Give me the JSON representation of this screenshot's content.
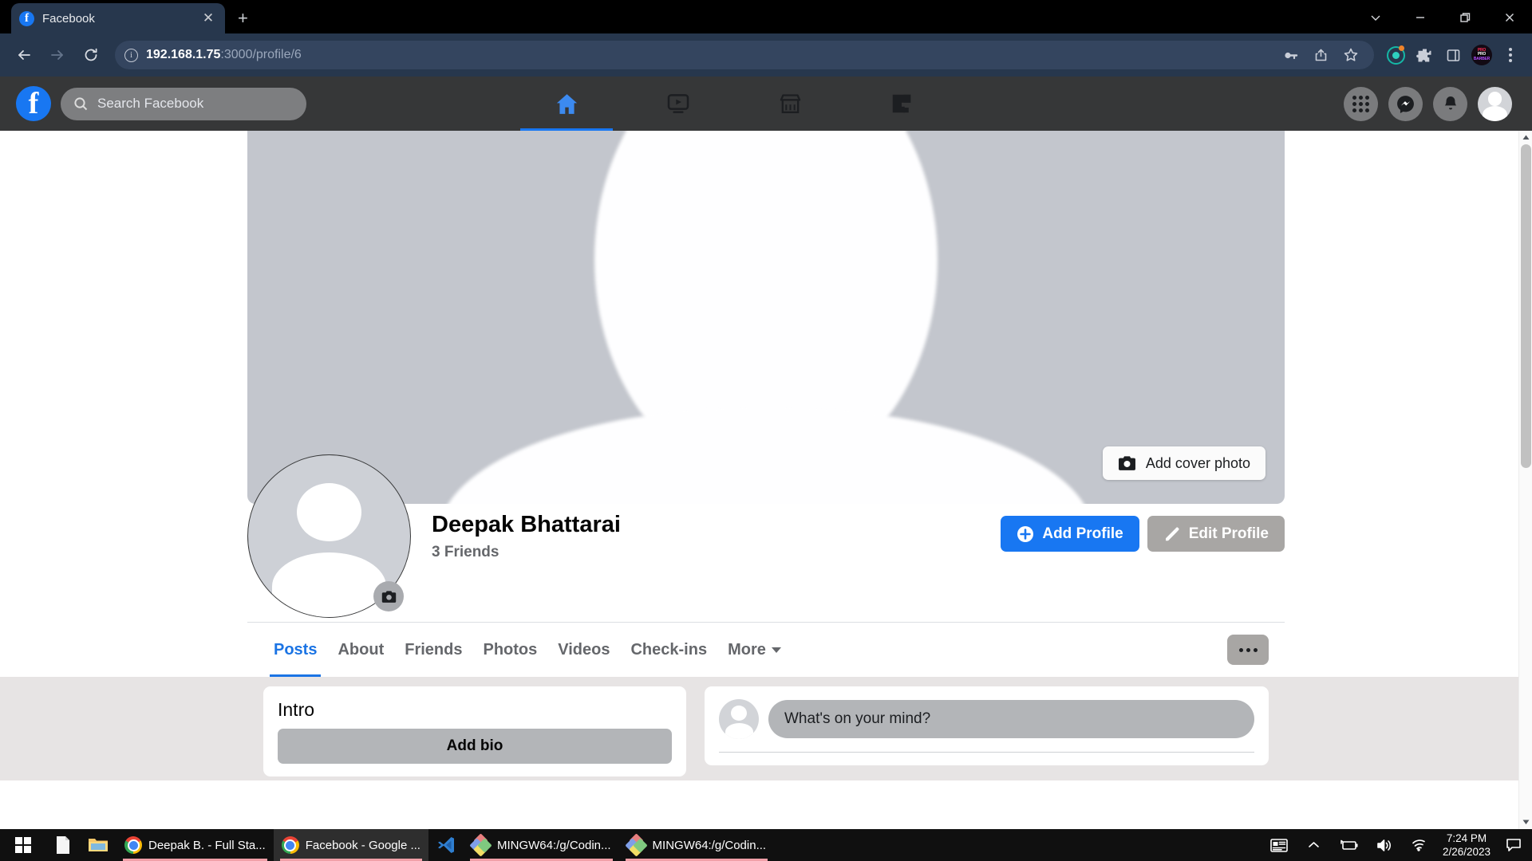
{
  "browser": {
    "tab": {
      "title": "Facebook",
      "favicon": "facebook-icon",
      "close": "✕"
    },
    "new_tab": "+",
    "window_controls": {
      "tab_search": "chevron-down-icon",
      "minimize": "minimize-icon",
      "restore": "restore-icon",
      "close": "close-icon"
    },
    "nav": {
      "back": "back-arrow-icon",
      "forward": "forward-arrow-icon",
      "reload": "reload-icon"
    },
    "omnibox": {
      "site_info": "info-icon",
      "url_host": "192.168.1.75",
      "url_path": ":3000/profile/6",
      "full_url": "192.168.1.75:3000/profile/6"
    },
    "toolbar_icons": [
      "key-icon",
      "share-icon",
      "bookmark-star-icon",
      "extension-circle-icon",
      "puzzle-extensions-icon",
      "side-panel-icon",
      "profile-badge-icon",
      "chrome-menu-icon"
    ],
    "extension_badge": {
      "line1": "PRO",
      "line2": "PRO",
      "line3": "BARBER"
    }
  },
  "fbnav": {
    "logo": "facebook-logo",
    "search": {
      "icon": "search-icon",
      "placeholder": "Search Facebook",
      "value": ""
    },
    "tabs": [
      {
        "name": "home",
        "icon": "home-icon",
        "active": true
      },
      {
        "name": "watch",
        "icon": "video-play-icon",
        "active": false
      },
      {
        "name": "marketplace",
        "icon": "marketplace-shop-icon",
        "active": false
      },
      {
        "name": "gaming",
        "icon": "gaming-icon",
        "active": false
      }
    ],
    "right": [
      {
        "name": "menu-grid",
        "icon": "grid-apps-icon"
      },
      {
        "name": "messenger",
        "icon": "messenger-icon"
      },
      {
        "name": "notifications",
        "icon": "bell-icon"
      },
      {
        "name": "account",
        "icon": "user-avatar-icon"
      }
    ]
  },
  "cover": {
    "add_cover_label": "Add cover photo",
    "camera_icon": "camera-icon",
    "background_color": "#c3c6cd"
  },
  "profile": {
    "name": "Deepak Bhattarai",
    "friends": "3 Friends",
    "avatar": "default-avatar",
    "camera_badge": "camera-icon",
    "actions": [
      {
        "name": "add-profile",
        "label": "Add Profile",
        "icon": "plus-circle-icon",
        "style": "primary",
        "color": "#1877f2"
      },
      {
        "name": "edit-profile",
        "label": "Edit Profile",
        "icon": "pencil-icon",
        "style": "secondary",
        "color": "#a8a6a4"
      }
    ]
  },
  "profile_tabs": {
    "items": [
      {
        "label": "Posts",
        "active": true
      },
      {
        "label": "About",
        "active": false
      },
      {
        "label": "Friends",
        "active": false
      },
      {
        "label": "Photos",
        "active": false
      },
      {
        "label": "Videos",
        "active": false
      },
      {
        "label": "Check-ins",
        "active": false
      },
      {
        "label": "More",
        "active": false,
        "caret": true
      }
    ],
    "overflow_button": "more-options-icon",
    "active_color": "#1b74e4"
  },
  "feed": {
    "intro": {
      "title": "Intro",
      "add_bio_label": "Add bio"
    },
    "composer": {
      "placeholder": "What's on your mind?",
      "avatar": "default-avatar"
    }
  },
  "taskbar": {
    "start": "windows-start-icon",
    "items": [
      {
        "name": "notepad",
        "icon": "document-icon",
        "label": ""
      },
      {
        "name": "file-explorer",
        "icon": "folder-icon",
        "label": ""
      },
      {
        "name": "chrome-deepak",
        "icon": "chrome-icon",
        "label": "Deepak B. - Full Sta...",
        "state": "running"
      },
      {
        "name": "chrome-facebook",
        "icon": "chrome-icon",
        "label": "Facebook - Google ...",
        "state": "active"
      },
      {
        "name": "vscode",
        "icon": "vscode-icon",
        "label": ""
      },
      {
        "name": "gitbash-1",
        "icon": "gitbash-icon",
        "label": "MINGW64:/g/Codin...",
        "state": "running"
      },
      {
        "name": "gitbash-2",
        "icon": "gitbash-icon",
        "label": "MINGW64:/g/Codin...",
        "state": "running"
      }
    ],
    "tray": {
      "icons": [
        "news-weather-icon",
        "show-hidden-icons-icon",
        "battery-charging-icon",
        "volume-icon",
        "wifi-icon"
      ],
      "time": "7:24 PM",
      "date": "2/26/2023",
      "action_center": "notification-icon"
    }
  }
}
